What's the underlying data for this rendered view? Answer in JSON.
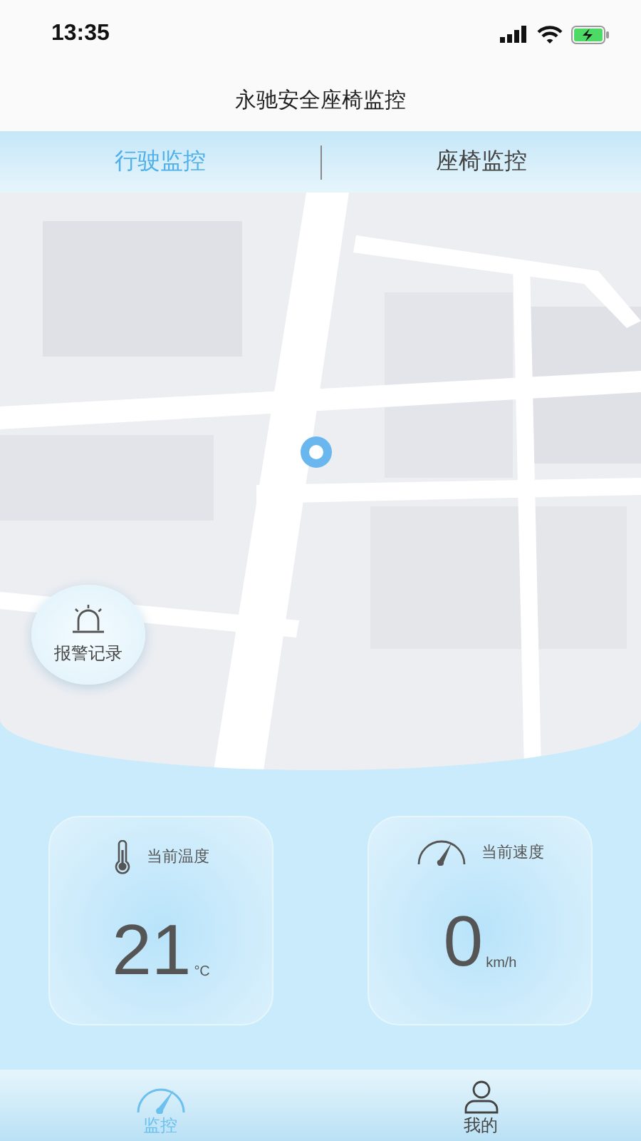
{
  "status_bar": {
    "time": "13:35"
  },
  "title": "永驰安全座椅监控",
  "tabs": [
    {
      "label": "行驶监控",
      "selected": true
    },
    {
      "label": "座椅监控",
      "selected": false
    }
  ],
  "map": {
    "kind": "picture",
    "alarm_button": "报警记录"
  },
  "cards": [
    {
      "kind": "temperature",
      "label": "当前温度",
      "value": "21",
      "unit": "°C"
    },
    {
      "kind": "speed",
      "label": "当前速度",
      "value": "0",
      "unit": "km/h"
    }
  ],
  "nav": [
    {
      "kind": "monitor",
      "label": "监控",
      "selected": true
    },
    {
      "kind": "profile",
      "label": "我的",
      "selected": false
    }
  ]
}
